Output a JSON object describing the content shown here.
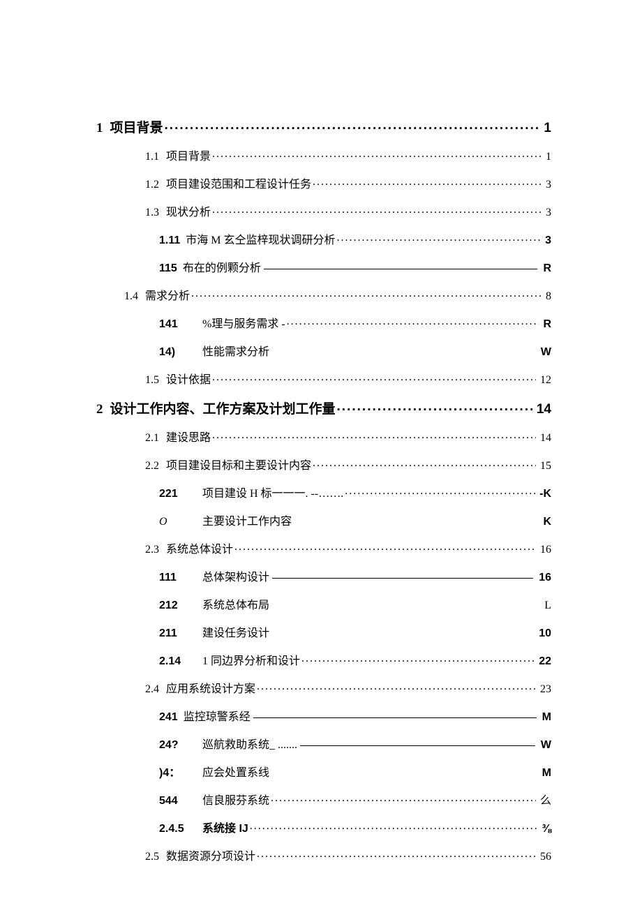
{
  "toc": [
    {
      "cls": "toc-row lvl-1",
      "num": "1",
      "title": "项目背景",
      "leader": "dots",
      "page": "1"
    },
    {
      "cls": "toc-row lvl-2",
      "num": "1.1",
      "title": "项目背景",
      "leader": "dots",
      "page": "1"
    },
    {
      "cls": "toc-row lvl-2",
      "num": "1.2",
      "title": "项目建设范围和工程设计任务",
      "leader": "dots",
      "page": "3"
    },
    {
      "cls": "toc-row lvl-2",
      "num": "1.3",
      "title": "现状分析",
      "leader": "dots",
      "page": "3"
    },
    {
      "cls": "toc-row lvl-3a",
      "num": "1.11",
      "title": "市海 M 玄仝监梓现状调研分析",
      "leader": "dots",
      "page": "3"
    },
    {
      "cls": "toc-row lvl-3a",
      "num": "115",
      "title": "布在的例颗分析",
      "leader": "line",
      "page": "R"
    },
    {
      "cls": "toc-row lvl-2",
      "num": "1.4",
      "title": "需求分析",
      "leader": "dots",
      "page": "8",
      "numStyle": "margin-left:40px;width:auto;"
    },
    {
      "cls": "toc-row lvl-3b",
      "num": "141",
      "title": "%理与服务需求              -",
      "leader": "dots",
      "page": "R"
    },
    {
      "cls": "toc-row lvl-3b",
      "num": "14)",
      "title": "性能需求分析",
      "leader": "none",
      "page": "W"
    },
    {
      "cls": "toc-row lvl-2",
      "num": "1.5",
      "title": "设计依据",
      "leader": "dots",
      "page": "12"
    },
    {
      "cls": "toc-row lvl-1",
      "num": "2",
      "title": "设计工作内容、工作方案及计划工作量",
      "leader": "dots",
      "page": "14"
    },
    {
      "cls": "toc-row lvl-2",
      "num": "2.1",
      "title": "建设思路",
      "leader": "dots",
      "page": "14"
    },
    {
      "cls": "toc-row lvl-2",
      "num": "2.2",
      "title": "项目建设目标和主要设计内容",
      "leader": "dots",
      "page": "15"
    },
    {
      "cls": "toc-row lvl-3b",
      "num": "221",
      "title": "项目建设 H 标一一一. --……. ",
      "leader": "dots",
      "page": "-K"
    },
    {
      "cls": "toc-row lvl-3b num-serif",
      "num": "O",
      "title": "主要设计工作内容",
      "leader": "none",
      "page": "K"
    },
    {
      "cls": "toc-row lvl-2",
      "num": "2.3",
      "title": "系统总体设计",
      "leader": "dots",
      "page": "16"
    },
    {
      "cls": "toc-row lvl-3b",
      "num": "111",
      "title": "总体架构设计",
      "leader": "line",
      "page": "16"
    },
    {
      "cls": "toc-row lvl-3b page-serif",
      "num": "212",
      "title": "系统总体布局",
      "leader": "none",
      "page": "L"
    },
    {
      "cls": "toc-row lvl-3b",
      "num": "211",
      "title": "建设任务设计",
      "leader": "none",
      "page": "10"
    },
    {
      "cls": "toc-row lvl-3b",
      "num": "2.14",
      "title": "1 同边界分析和设计",
      "leader": "dots",
      "page": "22"
    },
    {
      "cls": "toc-row lvl-2",
      "num": "2.4",
      "title": "应用系统设计方案",
      "leader": "dots",
      "page": "23"
    },
    {
      "cls": "toc-row lvl-3a",
      "num": "241",
      "title": "监控琼警系经",
      "leader": "line",
      "page": "M"
    },
    {
      "cls": "toc-row lvl-3b",
      "num": "24?",
      "title": "巡航救助系统_ .......",
      "leader": "line",
      "page": "W"
    },
    {
      "cls": "toc-row lvl-3b",
      "num": ")4：",
      "title": "应会处置系线",
      "leader": "none",
      "page": "M"
    },
    {
      "cls": "toc-row lvl-3b page-serif",
      "num": "544",
      "title": "信良服芬系统",
      "leader": "dots",
      "page": "么"
    },
    {
      "cls": "toc-row lvl-3b",
      "num": "2.4.5",
      "title": "系统接 IJ",
      "leader": "dots",
      "page": "⅜",
      "titleClass": "sys-acc"
    },
    {
      "cls": "toc-row lvl-2",
      "num": "2.5",
      "title": "数据资源分项设计",
      "leader": "dots",
      "page": "56"
    }
  ]
}
